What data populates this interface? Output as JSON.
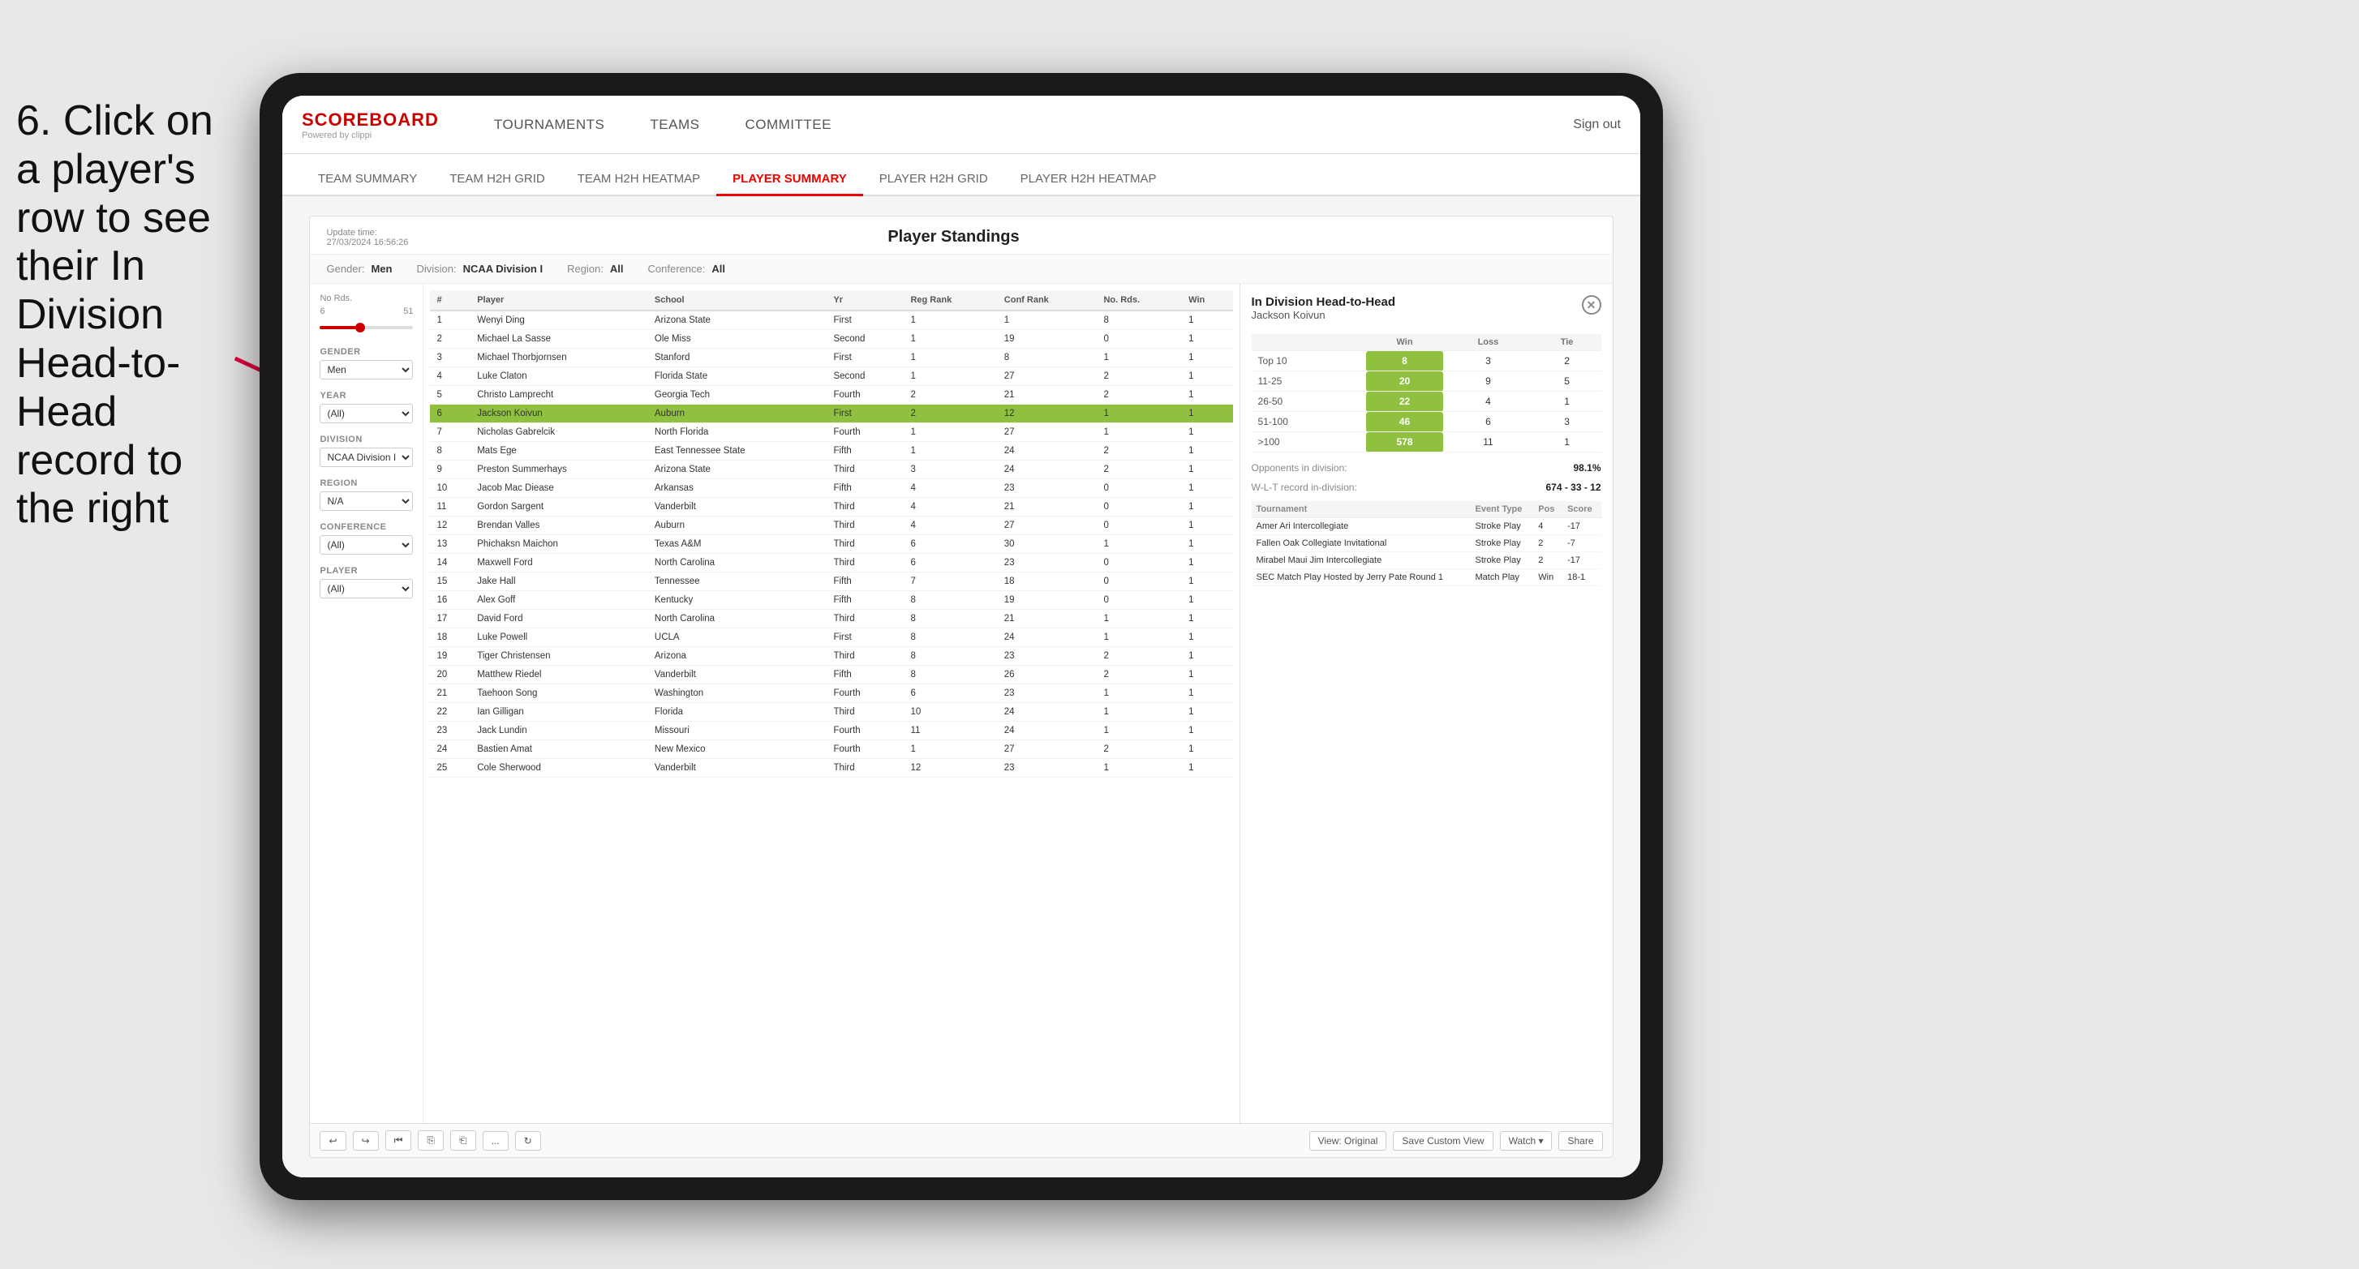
{
  "instruction": {
    "text": "6. Click on a player's row to see their In Division Head-to-Head record to the right"
  },
  "nav": {
    "logo_title": "SCOREBOARD",
    "logo_subtitle": "Powered by clippi",
    "items": [
      "TOURNAMENTS",
      "TEAMS",
      "COMMITTEE"
    ],
    "right_items": [
      "Sign out"
    ]
  },
  "sub_nav": {
    "items": [
      "TEAM SUMMARY",
      "TEAM H2H GRID",
      "TEAM H2H HEATMAP",
      "PLAYER SUMMARY",
      "PLAYER H2H GRID",
      "PLAYER H2H HEATMAP"
    ],
    "active": "PLAYER SUMMARY"
  },
  "dashboard": {
    "update_time": "Update time:",
    "update_date": "27/03/2024 16:56:26",
    "title": "Player Standings",
    "filters": {
      "gender_label": "Gender:",
      "gender_value": "Men",
      "division_label": "Division:",
      "division_value": "NCAA Division I",
      "region_label": "Region:",
      "region_value": "All",
      "conference_label": "Conference:",
      "conference_value": "All"
    }
  },
  "sidebar": {
    "no_rds_label": "No Rds.",
    "no_rds_range": "6",
    "no_rds_end": "51",
    "gender_label": "Gender",
    "gender_value": "Men",
    "year_label": "Year",
    "year_value": "(All)",
    "division_label": "Division",
    "division_value": "NCAA Division I",
    "region_label": "Region",
    "region_value": "N/A",
    "conference_label": "Conference",
    "conference_value": "(All)",
    "player_label": "Player",
    "player_value": "(All)"
  },
  "table": {
    "headers": [
      "#",
      "Player",
      "School",
      "Yr",
      "Reg Rank",
      "Conf Rank",
      "No. Rds.",
      "Win"
    ],
    "rows": [
      {
        "num": "1",
        "player": "Wenyi Ding",
        "school": "Arizona State",
        "yr": "First",
        "reg_rank": "1",
        "conf_rank": "1",
        "no_rds": "8",
        "win": "1"
      },
      {
        "num": "2",
        "player": "Michael La Sasse",
        "school": "Ole Miss",
        "yr": "Second",
        "reg_rank": "1",
        "conf_rank": "19",
        "no_rds": "0",
        "win": "1"
      },
      {
        "num": "3",
        "player": "Michael Thorbjornsen",
        "school": "Stanford",
        "yr": "First",
        "reg_rank": "1",
        "conf_rank": "8",
        "no_rds": "1",
        "win": "1"
      },
      {
        "num": "4",
        "player": "Luke Claton",
        "school": "Florida State",
        "yr": "Second",
        "reg_rank": "1",
        "conf_rank": "27",
        "no_rds": "2",
        "win": "1"
      },
      {
        "num": "5",
        "player": "Christo Lamprecht",
        "school": "Georgia Tech",
        "yr": "Fourth",
        "reg_rank": "2",
        "conf_rank": "21",
        "no_rds": "2",
        "win": "1"
      },
      {
        "num": "6",
        "player": "Jackson Koivun",
        "school": "Auburn",
        "yr": "First",
        "reg_rank": "2",
        "conf_rank": "12",
        "no_rds": "1",
        "win": "1",
        "selected": true
      },
      {
        "num": "7",
        "player": "Nicholas Gabrelcik",
        "school": "North Florida",
        "yr": "Fourth",
        "reg_rank": "1",
        "conf_rank": "27",
        "no_rds": "1",
        "win": "1"
      },
      {
        "num": "8",
        "player": "Mats Ege",
        "school": "East Tennessee State",
        "yr": "Fifth",
        "reg_rank": "1",
        "conf_rank": "24",
        "no_rds": "2",
        "win": "1"
      },
      {
        "num": "9",
        "player": "Preston Summerhays",
        "school": "Arizona State",
        "yr": "Third",
        "reg_rank": "3",
        "conf_rank": "24",
        "no_rds": "2",
        "win": "1"
      },
      {
        "num": "10",
        "player": "Jacob Mac Diease",
        "school": "Arkansas",
        "yr": "Fifth",
        "reg_rank": "4",
        "conf_rank": "23",
        "no_rds": "0",
        "win": "1"
      },
      {
        "num": "11",
        "player": "Gordon Sargent",
        "school": "Vanderbilt",
        "yr": "Third",
        "reg_rank": "4",
        "conf_rank": "21",
        "no_rds": "0",
        "win": "1"
      },
      {
        "num": "12",
        "player": "Brendan Valles",
        "school": "Auburn",
        "yr": "Third",
        "reg_rank": "4",
        "conf_rank": "27",
        "no_rds": "0",
        "win": "1"
      },
      {
        "num": "13",
        "player": "Phichaksn Maichon",
        "school": "Texas A&M",
        "yr": "Third",
        "reg_rank": "6",
        "conf_rank": "30",
        "no_rds": "1",
        "win": "1"
      },
      {
        "num": "14",
        "player": "Maxwell Ford",
        "school": "North Carolina",
        "yr": "Third",
        "reg_rank": "6",
        "conf_rank": "23",
        "no_rds": "0",
        "win": "1"
      },
      {
        "num": "15",
        "player": "Jake Hall",
        "school": "Tennessee",
        "yr": "Fifth",
        "reg_rank": "7",
        "conf_rank": "18",
        "no_rds": "0",
        "win": "1"
      },
      {
        "num": "16",
        "player": "Alex Goff",
        "school": "Kentucky",
        "yr": "Fifth",
        "reg_rank": "8",
        "conf_rank": "19",
        "no_rds": "0",
        "win": "1"
      },
      {
        "num": "17",
        "player": "David Ford",
        "school": "North Carolina",
        "yr": "Third",
        "reg_rank": "8",
        "conf_rank": "21",
        "no_rds": "1",
        "win": "1"
      },
      {
        "num": "18",
        "player": "Luke Powell",
        "school": "UCLA",
        "yr": "First",
        "reg_rank": "8",
        "conf_rank": "24",
        "no_rds": "1",
        "win": "1"
      },
      {
        "num": "19",
        "player": "Tiger Christensen",
        "school": "Arizona",
        "yr": "Third",
        "reg_rank": "8",
        "conf_rank": "23",
        "no_rds": "2",
        "win": "1"
      },
      {
        "num": "20",
        "player": "Matthew Riedel",
        "school": "Vanderbilt",
        "yr": "Fifth",
        "reg_rank": "8",
        "conf_rank": "26",
        "no_rds": "2",
        "win": "1"
      },
      {
        "num": "21",
        "player": "Taehoon Song",
        "school": "Washington",
        "yr": "Fourth",
        "reg_rank": "6",
        "conf_rank": "23",
        "no_rds": "1",
        "win": "1"
      },
      {
        "num": "22",
        "player": "Ian Gilligan",
        "school": "Florida",
        "yr": "Third",
        "reg_rank": "10",
        "conf_rank": "24",
        "no_rds": "1",
        "win": "1"
      },
      {
        "num": "23",
        "player": "Jack Lundin",
        "school": "Missouri",
        "yr": "Fourth",
        "reg_rank": "11",
        "conf_rank": "24",
        "no_rds": "1",
        "win": "1"
      },
      {
        "num": "24",
        "player": "Bastien Amat",
        "school": "New Mexico",
        "yr": "Fourth",
        "reg_rank": "1",
        "conf_rank": "27",
        "no_rds": "2",
        "win": "1"
      },
      {
        "num": "25",
        "player": "Cole Sherwood",
        "school": "Vanderbilt",
        "yr": "Third",
        "reg_rank": "12",
        "conf_rank": "23",
        "no_rds": "1",
        "win": "1"
      }
    ]
  },
  "h2h": {
    "title": "In Division Head-to-Head",
    "player": "Jackson Koivun",
    "table_headers": [
      "",
      "Win",
      "Loss",
      "Tie"
    ],
    "ranking_rows": [
      {
        "label": "Top 10",
        "win": "8",
        "loss": "3",
        "tie": "2"
      },
      {
        "label": "11-25",
        "win": "20",
        "loss": "9",
        "tie": "5"
      },
      {
        "label": "26-50",
        "win": "22",
        "loss": "4",
        "tie": "1"
      },
      {
        "label": "51-100",
        "win": "46",
        "loss": "6",
        "tie": "3"
      },
      {
        "label": ">100",
        "win": "578",
        "loss": "11",
        "tie": "1"
      }
    ],
    "opponents_pct_label": "Opponents in division:",
    "opponents_pct": "98.1%",
    "wlt_label": "W-L-T record in-division:",
    "wlt_value": "674 - 33 - 12",
    "tournaments_headers": [
      "Tournament",
      "Event Type",
      "Pos",
      "Score"
    ],
    "tournaments": [
      {
        "name": "Amer Ari Intercollegiate",
        "type": "Stroke Play",
        "pos": "4",
        "score": "-17"
      },
      {
        "name": "Fallen Oak Collegiate Invitational",
        "type": "Stroke Play",
        "pos": "2",
        "score": "-7"
      },
      {
        "name": "Mirabel Maui Jim Intercollegiate",
        "type": "Stroke Play",
        "pos": "2",
        "score": "-17"
      },
      {
        "name": "SEC Match Play Hosted by Jerry Pate Round 1",
        "type": "Match Play",
        "pos": "Win",
        "score": "18-1"
      }
    ]
  },
  "toolbar": {
    "undo": "↩",
    "redo": "↪",
    "skip_back": "⏮",
    "copy": "⎘",
    "paste": "⎗",
    "more": "...",
    "refresh": "↻",
    "view_original": "View: Original",
    "save_custom": "Save Custom View",
    "watch": "Watch ▾",
    "share": "Share"
  }
}
